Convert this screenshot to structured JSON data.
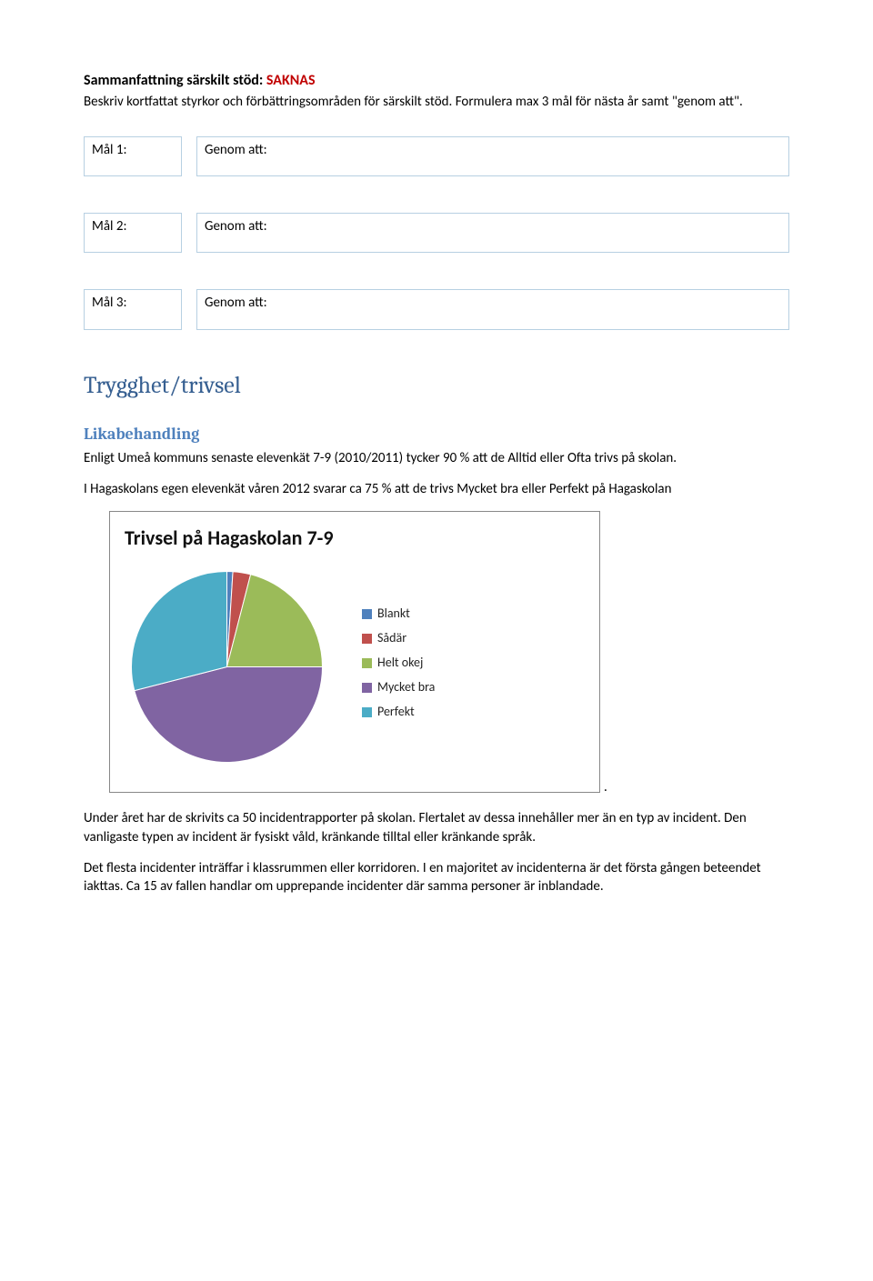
{
  "title": {
    "prefix": "Sammanfattning särskilt stöd: ",
    "status": "SAKNAS"
  },
  "intro": "Beskriv kortfattat styrkor och förbättringsområden för särskilt stöd. Formulera max 3 mål för nästa år samt \"genom att\".",
  "goals": [
    {
      "label": "Mål 1:",
      "value": "Genom att:"
    },
    {
      "label": "Mål 2:",
      "value": "Genom att:"
    },
    {
      "label": "Mål 3:",
      "value": "Genom att:"
    }
  ],
  "section_heading": "Trygghet/trivsel",
  "sub_heading": "Likabehandling",
  "para1": "Enligt Umeå kommuns senaste elevenkät 7-9 (2010/2011) tycker 90 % att de Alltid eller Ofta trivs på skolan.",
  "para2": "I Hagaskolans egen elevenkät våren 2012 svarar ca 75 % att de trivs Mycket bra eller Perfekt på Hagaskolan",
  "chart_data": {
    "type": "pie",
    "title": "Trivsel på Hagaskolan 7-9",
    "series": [
      {
        "name": "Blankt",
        "value": 1,
        "color": "#4f81bd"
      },
      {
        "name": "Sådär",
        "value": 3,
        "color": "#c0504d"
      },
      {
        "name": "Helt okej",
        "value": 21,
        "color": "#9bbb59"
      },
      {
        "name": "Mycket bra",
        "value": 46,
        "color": "#8064a2"
      },
      {
        "name": "Perfekt",
        "value": 29,
        "color": "#4bacc6"
      }
    ]
  },
  "para3": "Under året har de skrivits ca 50 incidentrapporter på skolan. Flertalet av dessa innehåller mer än en typ av incident. Den vanligaste typen av incident är fysiskt våld, kränkande tilltal eller kränkande språk.",
  "para4": "Det flesta incidenter inträffar i klassrummen eller korridoren. I en majoritet av incidenterna är det första gången beteendet iakttas. Ca 15 av fallen handlar om upprepande incidenter där samma personer är inblandade."
}
